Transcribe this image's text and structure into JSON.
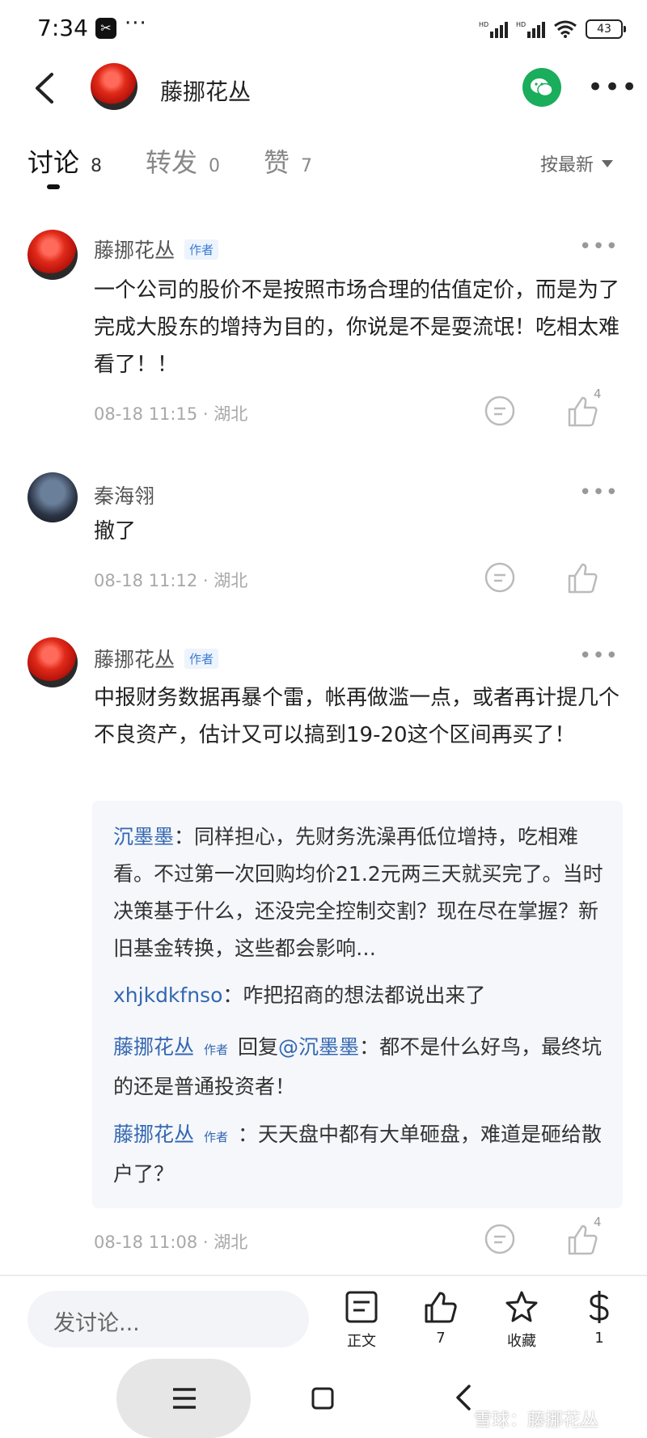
{
  "status_bar": {
    "time": "7:34",
    "app_icon": "capcut-icon",
    "dots": "···",
    "battery": "43"
  },
  "header": {
    "title": "藤挪花丛"
  },
  "tabs": [
    {
      "label": "讨论",
      "count": "8"
    },
    {
      "label": "转发",
      "count": "0"
    },
    {
      "label": "赞",
      "count": "7"
    }
  ],
  "sort": {
    "label": "按最新"
  },
  "comments": [
    {
      "user": "藤挪花丛",
      "badge": "作者",
      "text": "一个公司的股价不是按照市场合理的估值定价，而是为了完成大股东的增持为目的，你说是不是耍流氓！吃相太难看了！！",
      "time": "08-18 11:15 · 湖北",
      "likes": "4"
    },
    {
      "user": "秦海翎",
      "text": "撤了",
      "time": "08-18 11:12 · 湖北"
    },
    {
      "user": "藤挪花丛",
      "badge": "作者",
      "text": "中报财务数据再暴个雷，帐再做滥一点，或者再计提几个不良资产，估计又可以搞到19-20这个区间再买了！",
      "time": "08-18 11:08 · 湖北",
      "likes": "4",
      "replies": [
        {
          "user": "沉墨墨",
          "sep": "：",
          "text": "同样担心，先财务洗澡再低位增持，吃相难看。不过第一次回购均价21.2元两三天就买完了。当时决策基于什么，还没完全控制交割？现在尽在掌握？新旧基金转换，这些都会影响…"
        },
        {
          "user": "xhjkdkfnso",
          "sep": "：",
          "text": "咋把招商的想法都说出来了"
        },
        {
          "user": "藤挪花丛",
          "tag": "作者",
          "reply_prefix": "回复",
          "mention": "@沉墨墨",
          "sep": "：",
          "text": "都不是什么好鸟，最终坑的还是普通投资者！"
        },
        {
          "user": "藤挪花丛",
          "tag": "作者",
          "sep": "：",
          "text": "天天盘中都有大单砸盘，难道是砸给散户了？"
        }
      ]
    }
  ],
  "bottom_bar": {
    "input_placeholder": "发讨论...",
    "tools": [
      {
        "label": "正文",
        "icon": "article-icon"
      },
      {
        "label": "7",
        "icon": "thumbs-up-icon"
      },
      {
        "label": "收藏",
        "icon": "star-icon"
      },
      {
        "label": "1",
        "icon": "dollar-icon"
      }
    ]
  },
  "watermark": "雪球：藤挪花丛"
}
